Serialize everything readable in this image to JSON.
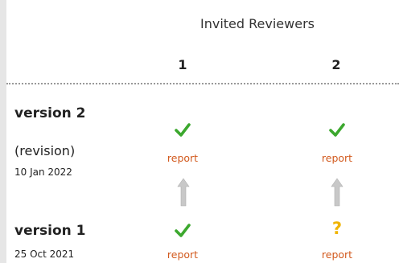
{
  "colors": {
    "accent": "#d25a1e",
    "approved": "#3ca82e",
    "reservations": "#f0b400",
    "arrow": "#c8c8c8"
  },
  "header": {
    "title": "Invited Reviewers"
  },
  "reviewers": [
    "1",
    "2"
  ],
  "versions": [
    {
      "label": "version 2",
      "note": "(revision)",
      "date": "10 Jan 2022",
      "reports": [
        {
          "status_icon": "checkmark-icon",
          "link": "report"
        },
        {
          "status_icon": "checkmark-icon",
          "link": "report"
        }
      ]
    },
    {
      "label": "version 1",
      "note": "",
      "date": "25 Oct 2021",
      "reports": [
        {
          "status_icon": "checkmark-icon",
          "link": "report"
        },
        {
          "status_icon": "question-mark-icon",
          "link": "report"
        }
      ]
    }
  ]
}
